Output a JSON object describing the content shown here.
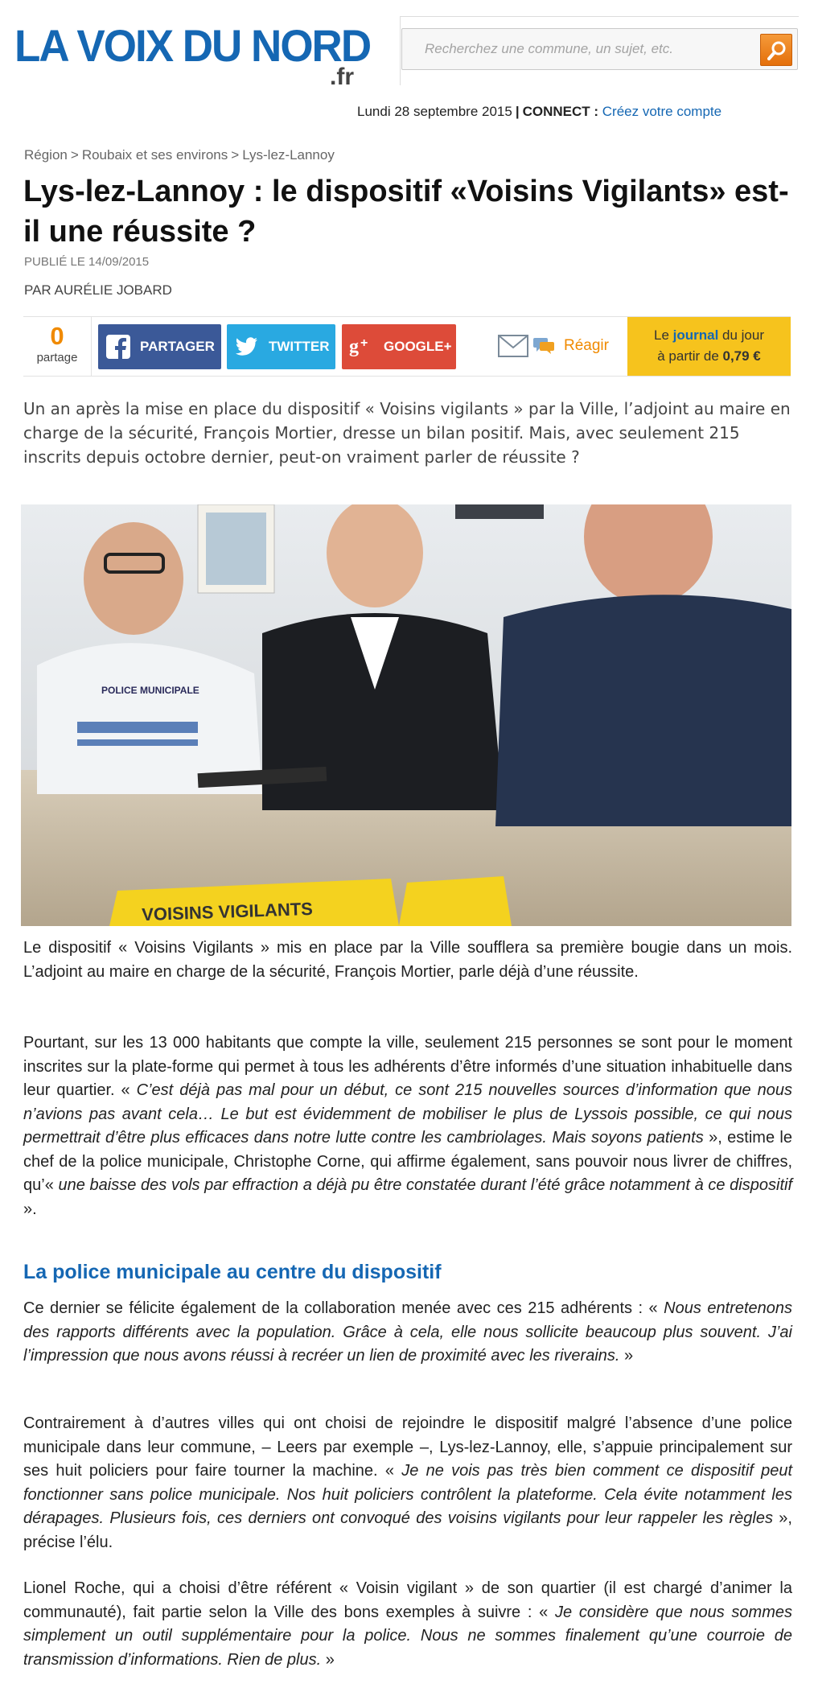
{
  "header": {
    "logo_text": "LA VOIX DU NORD",
    "logo_tld": ".fr",
    "search_placeholder": "Recherchez une commune, un sujet, etc.",
    "date": "Lundi 28 septembre 2015",
    "connect_label": "CONNECT :",
    "create_account": "Créez votre compte",
    "colors": {
      "brand": "#1567b3",
      "accent": "#f08a00"
    }
  },
  "breadcrumb": [
    "Région",
    "Roubaix et ses environs",
    "Lys-lez-Lannoy"
  ],
  "article": {
    "title": "Lys-lez-Lannoy : le dispositif «Voisins Vigilants» est-il une réussite ?",
    "published": "PUBLIÉ LE 14/09/2015",
    "author": "PAR AURÉLIE JOBARD",
    "lead": "Un an après la mise en place du dispositif « Voisins vigilants » par la Ville, l’adjoint au maire en charge de la sécurité, François Mortier, dresse un bilan positif. Mais, avec seulement 215 inscrits depuis octobre dernier, peut-on vraiment parler de réussite ?",
    "photo_sign_text": "VOISINS VIGILANTS",
    "photo_badge_text": "POLICE MUNICIPALE",
    "p1": "Le dispositif « Voisins Vigilants » mis en place par la Ville soufflera sa première bougie dans un mois. L’adjoint au maire en charge de la sécurité, François Mortier, parle déjà d’une réussite.",
    "p2a": "Pourtant, sur les 13 000 habitants que compte la ville, seulement 215 personnes se sont pour le moment inscrites sur la plate-forme qui permet à tous les adhérents d’être informés d’une situation inhabituelle dans leur quartier. « ",
    "p2b": "C’est déjà pas mal pour un début, ce sont 215 nouvelles sources d’information que nous n’avions pas avant cela… Le but est évidemment de mobiliser le plus de Lyssois possible, ce qui nous permettrait d’être plus efficaces dans notre lutte contre les cambriolages. Mais soyons patients",
    "p2c": " », estime le chef de la police municipale, Christophe Corne, qui affirme également, sans pouvoir nous livrer de chiffres, qu’« ",
    "p2d": "une baisse des vols par effraction a déjà pu être constatée durant l’été grâce notamment à ce dispositif",
    "p2e": " ».",
    "subhead": "La police municipale au centre du dispositif",
    "p3a": "Ce dernier se félicite également de la collaboration menée avec ces 215 adhérents : « ",
    "p3b": "Nous entretenons des rapports différents avec la population. Grâce à cela, elle nous sollicite beaucoup plus souvent. J’ai l’impression que nous avons réussi à recréer un lien de proximité avec les riverains.",
    "p3c": " »",
    "p4a": "Contrairement à d’autres villes qui ont choisi de rejoindre le dispositif malgré l’absence d’une police municipale dans leur commune, – Leers par exemple –, Lys-lez-Lannoy, elle, s’appuie principalement sur ses huit policiers pour faire tourner la machine. « ",
    "p4b": "Je ne vois pas très bien comment ce dispositif peut fonctionner sans police municipale. Nos huit policiers contrôlent la plateforme. Cela évite notamment les dérapages. Plusieurs fois, ces derniers ont convoqué des voisins vigilants pour leur rappeler les règles",
    "p4c": " », précise l’élu.",
    "p5a": "Lionel Roche, qui a choisi d’être référent « Voisin vigilant » de son quartier (il est chargé d’animer la communauté), fait partie selon la Ville des bons exemples à suivre : « ",
    "p5b": "Je considère que nous sommes simplement un outil supplémentaire pour la police. Nous ne sommes finalement qu’une courroie de transmission d’informations. Rien de plus.",
    "p5c": " »"
  },
  "share": {
    "count": "0",
    "count_label": "partage",
    "facebook": "PARTAGER",
    "twitter": "TWITTER",
    "google": "GOOGLE+",
    "react": "Réagir",
    "journal_line1_pre": "Le ",
    "journal_word": "journal",
    "journal_line1_post": " du jour",
    "journal_line2_pre": "à partir de ",
    "journal_price": "0,79 €"
  }
}
